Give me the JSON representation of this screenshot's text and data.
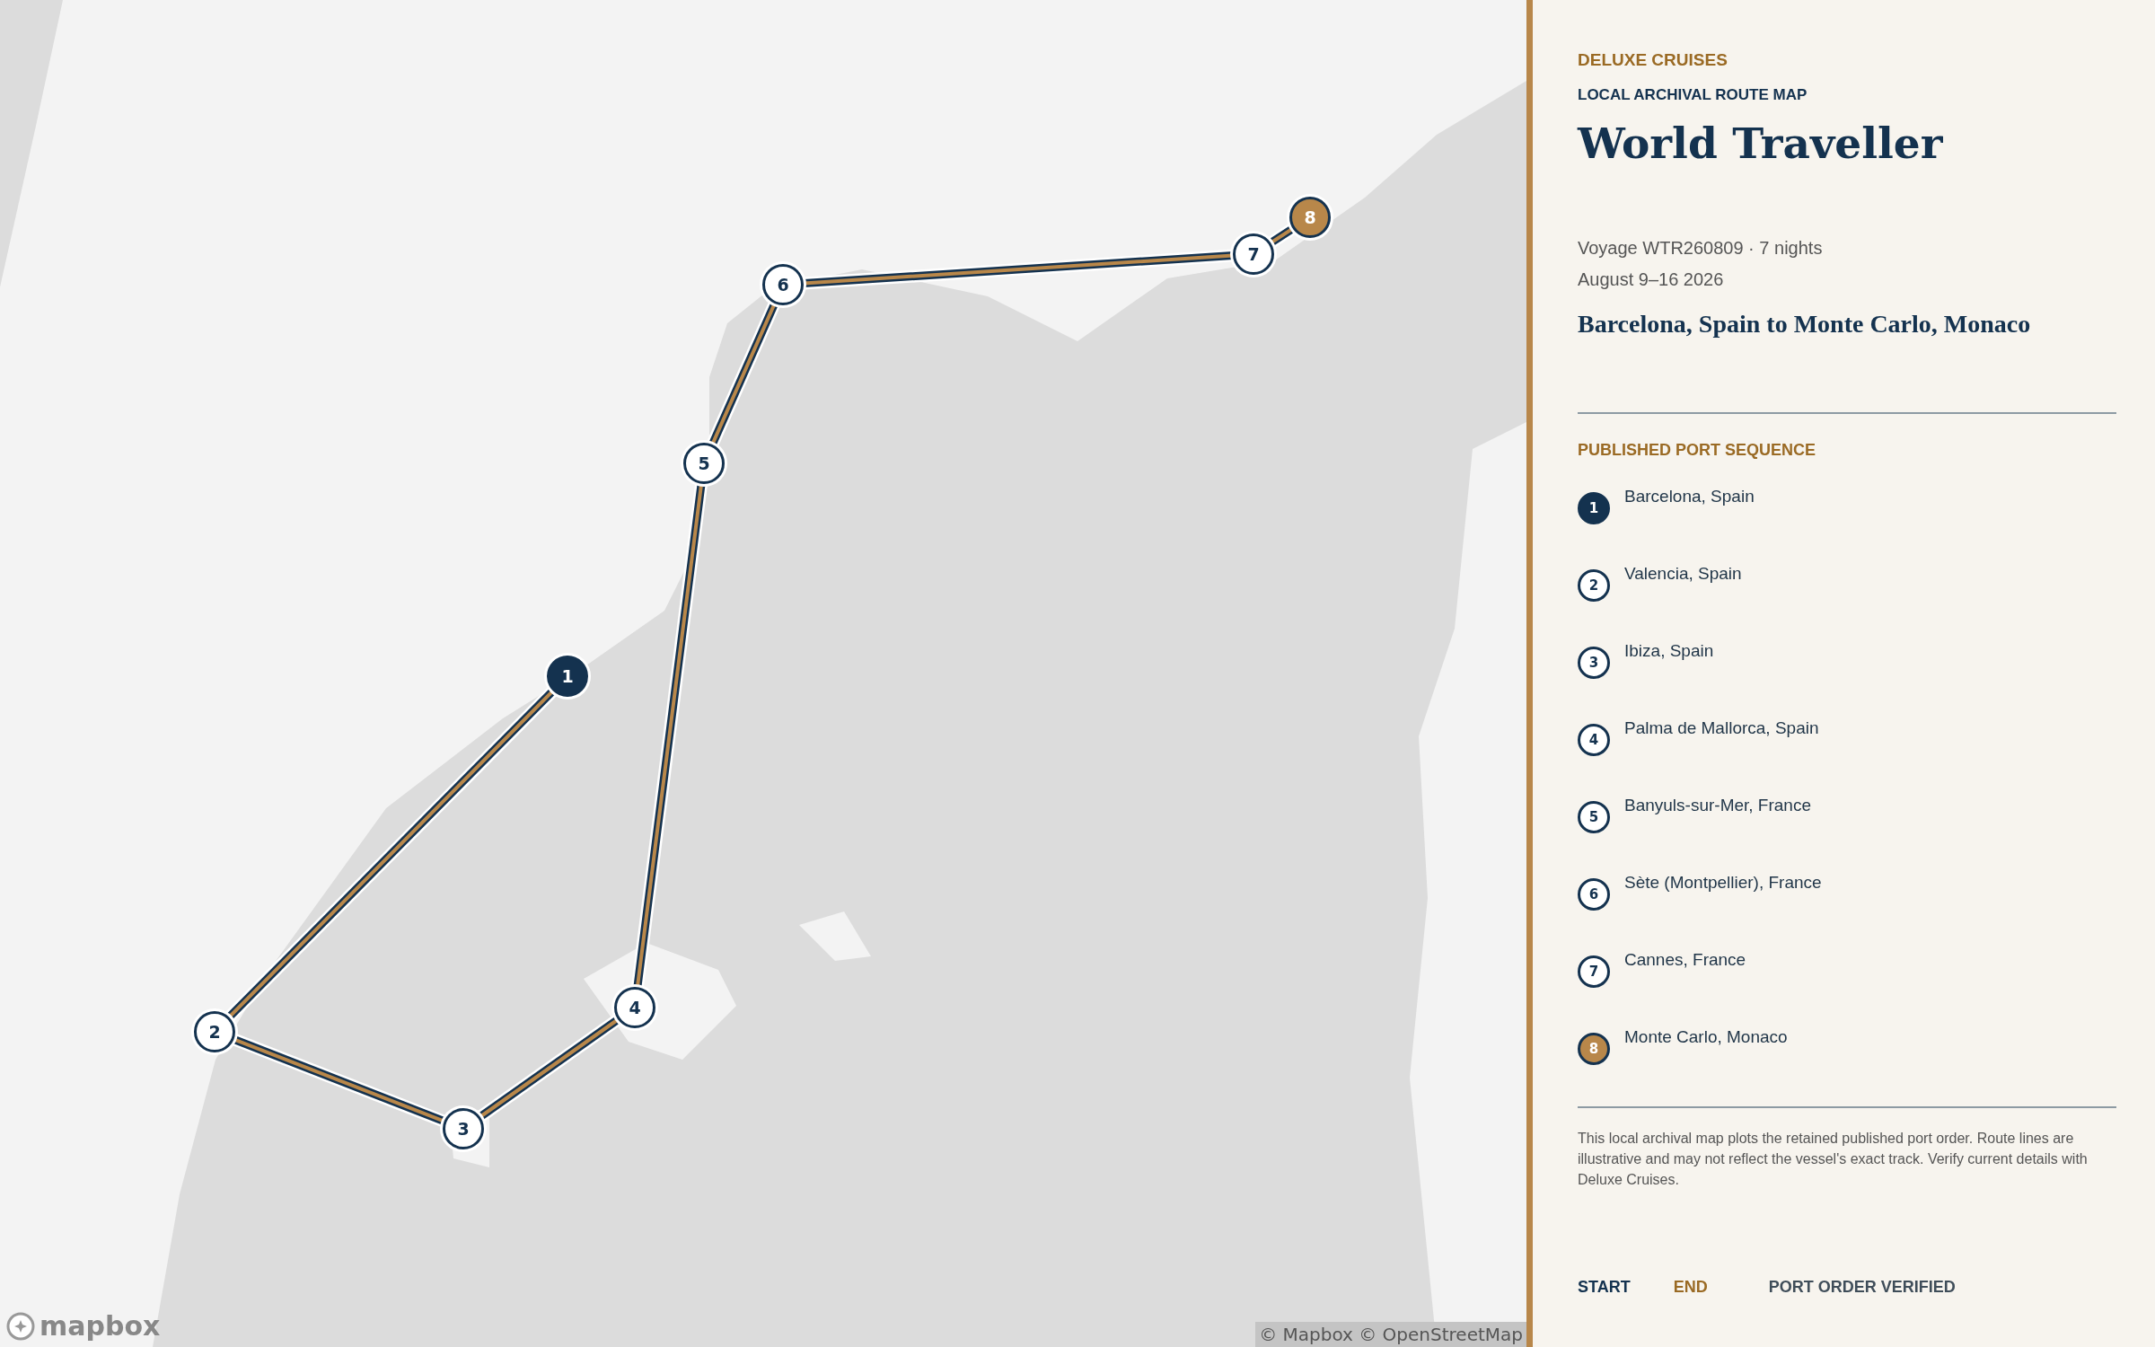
{
  "map": {
    "markers": [
      {
        "label": "1",
        "kind": "start"
      },
      {
        "label": "2",
        "kind": "stop"
      },
      {
        "label": "3",
        "kind": "stop"
      },
      {
        "label": "4",
        "kind": "stop"
      },
      {
        "label": "5",
        "kind": "stop"
      },
      {
        "label": "6",
        "kind": "stop"
      },
      {
        "label": "7",
        "kind": "stop"
      },
      {
        "label": "8",
        "kind": "end"
      }
    ],
    "logo": "mapbox",
    "attribution": "© Mapbox © OpenStreetMap"
  },
  "panel": {
    "brand": "DELUXE CRUISES",
    "eyebrow": "LOCAL ARCHIVAL ROUTE MAP",
    "title": "World Traveller",
    "voyage": "Voyage WTR260809 · 7 nights",
    "dates": "August 9–16 2026",
    "route": "Barcelona, Spain to Monte Carlo, Monaco",
    "sequence_heading": "PUBLISHED PORT SEQUENCE",
    "ports": [
      {
        "number": "1",
        "name": "Barcelona, Spain",
        "kind": "start"
      },
      {
        "number": "2",
        "name": "Valencia, Spain",
        "kind": "stop"
      },
      {
        "number": "3",
        "name": "Ibiza, Spain",
        "kind": "stop"
      },
      {
        "number": "4",
        "name": "Palma de Mallorca, Spain",
        "kind": "stop"
      },
      {
        "number": "5",
        "name": "Banyuls-sur-Mer, France",
        "kind": "stop"
      },
      {
        "number": "6",
        "name": "Sète (Montpellier), France",
        "kind": "stop"
      },
      {
        "number": "7",
        "name": "Cannes, France",
        "kind": "stop"
      },
      {
        "number": "8",
        "name": "Monte Carlo, Monaco",
        "kind": "end"
      }
    ],
    "disclaimer": "This local archival map plots the retained published port order. Route lines are illustrative and may not reflect the vessel's exact track. Verify current details with Deluxe Cruises.",
    "legend": [
      {
        "label": "START",
        "kind": "start"
      },
      {
        "label": "END",
        "kind": "end"
      },
      {
        "label": "PORT ORDER VERIFIED",
        "kind": "note"
      }
    ]
  }
}
